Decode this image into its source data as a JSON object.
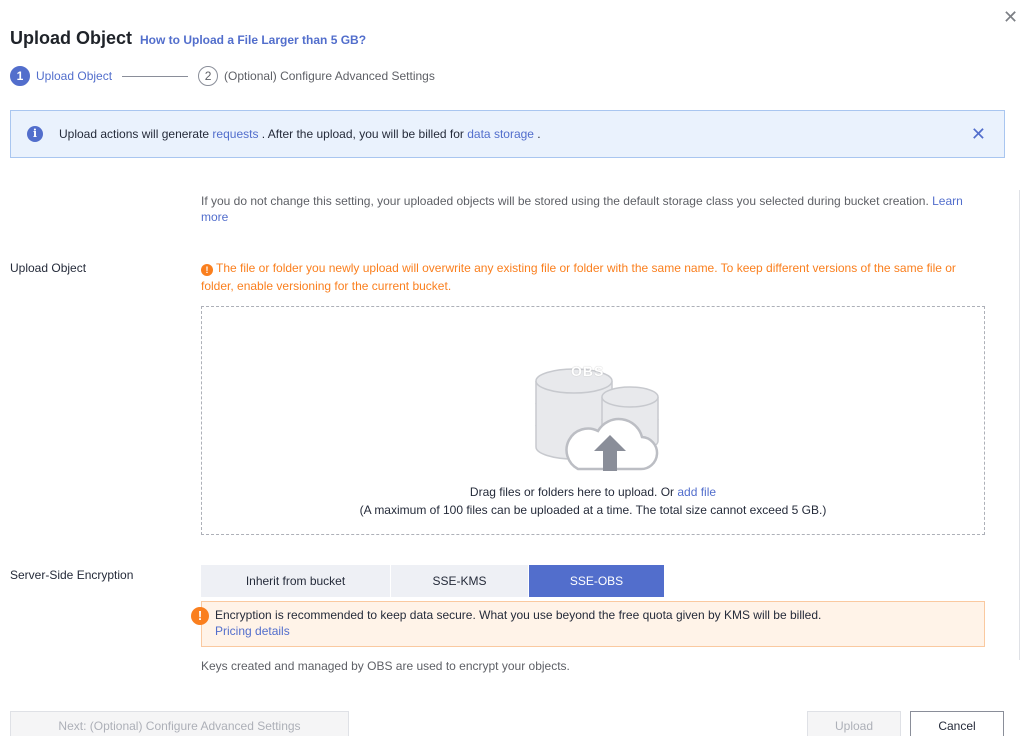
{
  "dialog": {
    "title": "Upload Object",
    "title_link": "How to Upload a File Larger than 5 GB?",
    "close_glyph": "✕"
  },
  "steps": [
    {
      "number": "1",
      "label": "Upload Object",
      "state": "active"
    },
    {
      "number": "2",
      "label": "(Optional) Configure Advanced Settings",
      "state": "inactive"
    }
  ],
  "info_bar": {
    "text_before": "Upload actions will generate ",
    "link1": "requests",
    "text_middle": " . After the upload, you will be billed for ",
    "link2": "data storage",
    "text_after": " .",
    "close_glyph": "✕"
  },
  "storage_note": {
    "text": "If you do not change this setting, your uploaded objects will be stored using the default storage class you selected during bucket creation. ",
    "link": "Learn more"
  },
  "upload_row": {
    "label": "Upload Object",
    "warning": "The file or folder you newly upload will overwrite any existing file or folder with the same name. To keep different versions of the same file or folder, enable versioning for the current bucket.",
    "icon_label": "OBS",
    "drop_text": "Drag files or folders here to upload. Or ",
    "drop_link": "add file",
    "drop_limit": "(A maximum of 100 files can be uploaded at a time. The total size cannot exceed 5 GB.)"
  },
  "encryption": {
    "label": "Server-Side Encryption",
    "options": [
      "Inherit from bucket",
      "SSE-KMS",
      "SSE-OBS"
    ],
    "selected": "SSE-OBS",
    "note_text": "Encryption is recommended to keep data secure. What you use beyond the free quota given by KMS will be billed.",
    "note_link": "Pricing details",
    "keys_note": "Keys created and managed by OBS are used to encrypt your objects."
  },
  "footer": {
    "next_label": "Next: (Optional) Configure Advanced Settings",
    "upload_label": "Upload",
    "cancel_label": "Cancel"
  },
  "colors": {
    "accent": "#526ecc",
    "warning": "#fa7f1e",
    "info_bg": "#eaf2fd"
  }
}
